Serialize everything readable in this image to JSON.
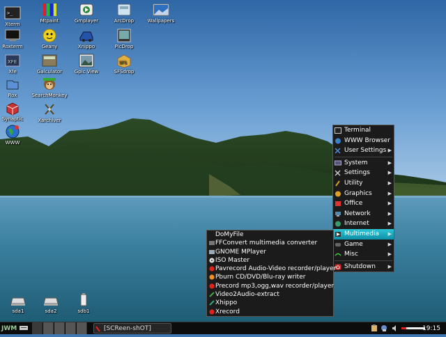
{
  "desktop": {
    "icons": [
      {
        "label": "Xterm",
        "icon": "terminal-icon"
      },
      {
        "label": "Mtpaint",
        "icon": "paint-icon"
      },
      {
        "label": "Gmplayer",
        "icon": "media-player-icon"
      },
      {
        "label": "ArcDrop",
        "icon": "archive-drop-icon"
      },
      {
        "label": "Wallpapers",
        "icon": "wallpaper-icon"
      },
      {
        "label": "Roxterm",
        "icon": "terminal-icon"
      },
      {
        "label": "Geany",
        "icon": "geany-icon"
      },
      {
        "label": "Xnippo",
        "icon": "xnippo-icon"
      },
      {
        "label": "PicDrop",
        "icon": "picture-drop-icon"
      },
      {
        "label": "Xfe",
        "icon": "file-manager-icon"
      },
      {
        "label": "Galculator",
        "icon": "calculator-icon"
      },
      {
        "label": "Gpic View",
        "icon": "image-viewer-icon"
      },
      {
        "label": "SFSdrop",
        "icon": "sfs-drop-icon"
      },
      {
        "label": "Rox",
        "icon": "rox-icon"
      },
      {
        "label": "SearchMonkey",
        "icon": "search-monkey-icon"
      },
      {
        "label": "Synaptic",
        "icon": "package-icon"
      },
      {
        "label": "Xarchiver",
        "icon": "archiver-icon"
      },
      {
        "label": "WWW",
        "icon": "globe-icon"
      }
    ],
    "drives": [
      {
        "label": "sda1",
        "icon": "drive-icon"
      },
      {
        "label": "sda2",
        "icon": "drive-icon"
      },
      {
        "label": "sdb1",
        "icon": "usb-drive-icon"
      }
    ]
  },
  "main_menu": {
    "items": [
      {
        "label": "Terminal",
        "icon": "terminal-icon",
        "submenu": false
      },
      {
        "label": "WWW Browser",
        "icon": "globe-icon",
        "submenu": false
      },
      {
        "label": "User Settings",
        "icon": "tools-icon",
        "submenu": true
      },
      {
        "label": "System",
        "icon": "system-icon",
        "submenu": true
      },
      {
        "label": "Settings",
        "icon": "settings-icon",
        "submenu": true
      },
      {
        "label": "Utility",
        "icon": "utility-icon",
        "submenu": true
      },
      {
        "label": "Graphics",
        "icon": "graphics-icon",
        "submenu": true
      },
      {
        "label": "Office",
        "icon": "office-icon",
        "submenu": true
      },
      {
        "label": "Network",
        "icon": "network-icon",
        "submenu": true
      },
      {
        "label": "Internet",
        "icon": "internet-icon",
        "submenu": true
      },
      {
        "label": "Multimedia",
        "icon": "multimedia-icon",
        "submenu": true,
        "selected": true
      },
      {
        "label": "Game",
        "icon": "game-icon",
        "submenu": true
      },
      {
        "label": "Misc",
        "icon": "misc-icon",
        "submenu": true
      },
      {
        "label": "Shutdown",
        "icon": "shutdown-icon",
        "submenu": true
      }
    ]
  },
  "multimedia_menu": {
    "items": [
      {
        "label": "DoMyFile",
        "icon": ""
      },
      {
        "label": "FFConvert multimedia converter",
        "icon": "convert-icon"
      },
      {
        "label": "GNOME MPlayer",
        "icon": "mplayer-icon"
      },
      {
        "label": "ISO Master",
        "icon": "disc-icon"
      },
      {
        "label": "Pavrecord Audio-Video recorder/player",
        "icon": "record-icon"
      },
      {
        "label": "Pburn CD/DVD/Blu-ray writer",
        "icon": "burn-icon"
      },
      {
        "label": "Precord mp3,ogg,wav recorder/player",
        "icon": "record-icon"
      },
      {
        "label": "Video2Audio-extract",
        "icon": "video-audio-icon"
      },
      {
        "label": "Xhippo",
        "icon": "xhippo-icon"
      },
      {
        "label": "Xrecord",
        "icon": "record-icon"
      }
    ]
  },
  "taskbar": {
    "start_label": "JWM",
    "task_label": "[SCReen-shOT]",
    "clock": "19:15",
    "volume_level": 0.2
  },
  "colors": {
    "menu_bg": "#1b1b1b",
    "menu_selected": "#1aa9bd",
    "taskbar_bg": "#0c0c0c",
    "record_red": "#e0241c"
  }
}
